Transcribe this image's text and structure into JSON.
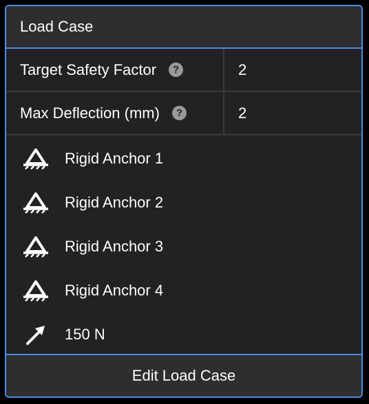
{
  "panel": {
    "title": "Load Case",
    "params": [
      {
        "label": "Target Safety Factor",
        "help": "?",
        "value": "2"
      },
      {
        "label": "Max Deflection (mm)",
        "help": "?",
        "value": "2"
      }
    ],
    "items": [
      {
        "icon": "anchor-icon",
        "label": "Rigid Anchor 1"
      },
      {
        "icon": "anchor-icon",
        "label": "Rigid Anchor 2"
      },
      {
        "icon": "anchor-icon",
        "label": "Rigid Anchor 3"
      },
      {
        "icon": "anchor-icon",
        "label": "Rigid Anchor 4"
      },
      {
        "icon": "force-arrow-icon",
        "label": "150 N"
      }
    ],
    "footer_button": "Edit Load Case"
  },
  "colors": {
    "accent_border": "#4a90e2",
    "panel_bg": "#232123",
    "header_bg": "#2f2d2f"
  }
}
